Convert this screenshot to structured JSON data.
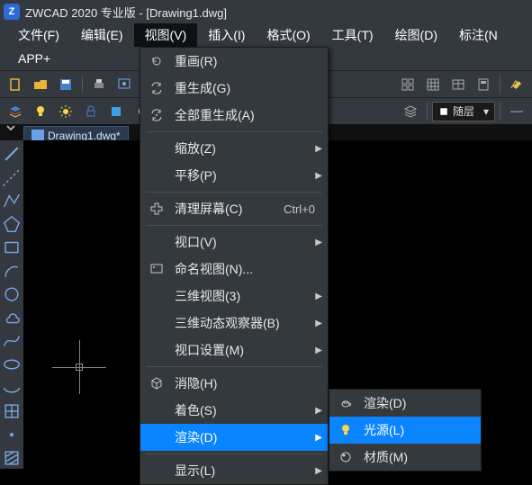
{
  "title_bar": {
    "app_name": "ZWCAD 2020 专业版",
    "doc_name": "[Drawing1.dwg]"
  },
  "menu_bar": {
    "file": "文件(F)",
    "edit": "编辑(E)",
    "view": "视图(V)",
    "insert": "插入(I)",
    "format": "格式(O)",
    "tools": "工具(T)",
    "draw": "绘图(D)",
    "dim": "标注(N"
  },
  "menu_bar2": {
    "app_plus": "APP+"
  },
  "layer_combo": {
    "value": "随层"
  },
  "doc_tab": {
    "label": "Drawing1.dwg*"
  },
  "view_menu": {
    "redraw": "重画(R)",
    "regen": "重生成(G)",
    "regen_all": "全部重生成(A)",
    "zoom": "缩放(Z)",
    "pan": "平移(P)",
    "clean_screen": "清理屏幕(C)",
    "clean_shortcut": "Ctrl+0",
    "viewport": "视口(V)",
    "named_views": "命名视图(N)...",
    "views_3d": "三维视图(3)",
    "orbit_3d": "三维动态观察器(B)",
    "viewport_cfg": "视口设置(M)",
    "hide": "消隐(H)",
    "shade": "着色(S)",
    "render": "渲染(D)",
    "display": "显示(L)"
  },
  "render_submenu": {
    "render": "渲染(D)",
    "light": "光源(L)",
    "material": "材质(M)"
  }
}
